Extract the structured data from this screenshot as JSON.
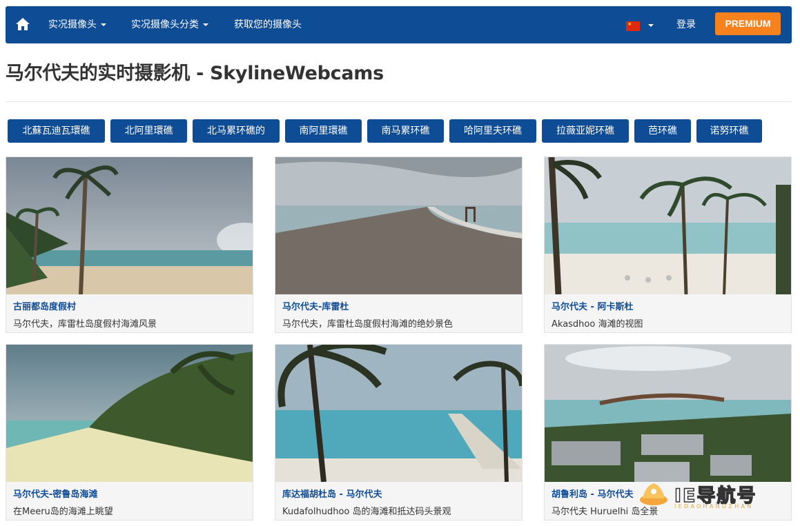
{
  "nav": {
    "items": [
      {
        "label": "实况摄像头",
        "has_caret": true
      },
      {
        "label": "实况摄像头分类",
        "has_caret": true
      },
      {
        "label": "获取您的摄像头",
        "has_caret": false
      }
    ],
    "login": "登录",
    "premium": "PREMIUM",
    "language_flag": "china-flag-icon"
  },
  "page_title": "马尔代夫的实时摄影机 - SkylineWebcams",
  "tags": [
    "北蘇瓦迪瓦環礁",
    "北阿里環礁",
    "北马累环礁的",
    "南阿里環礁",
    "南马累环礁",
    "哈阿里夫环礁",
    "拉薇亚妮环礁",
    "芭环礁",
    "诺努环礁"
  ],
  "cards": [
    {
      "title": "古丽都岛度假村",
      "desc": "马尔代夫，库雷杜岛度假村海滩风景"
    },
    {
      "title": "马尔代夫-库雷杜",
      "desc": "马尔代夫，库雷杜岛度假村海滩的绝妙景色"
    },
    {
      "title": "马尔代夫 - 阿卡斯杜",
      "desc": "Akasdhoo 海滩的视图"
    },
    {
      "title": "马尔代夫-密鲁岛海滩",
      "desc": "在Meeru岛的海滩上眺望"
    },
    {
      "title": "库达福胡杜岛 - 马尔代夫",
      "desc": "Kudafolhudhoo 岛的海滩和抵达码头景观"
    },
    {
      "title": "胡鲁利岛 - 马尔代夫",
      "desc": "马尔代夫 Huruelhi 岛全景"
    }
  ],
  "watermark": {
    "text": "IE导航号",
    "sub": "IEDAOHANGZHAN"
  },
  "colors": {
    "brand_blue": "#0f4c96",
    "premium_orange": "#f7811d",
    "card_title": "#0f4c96"
  }
}
